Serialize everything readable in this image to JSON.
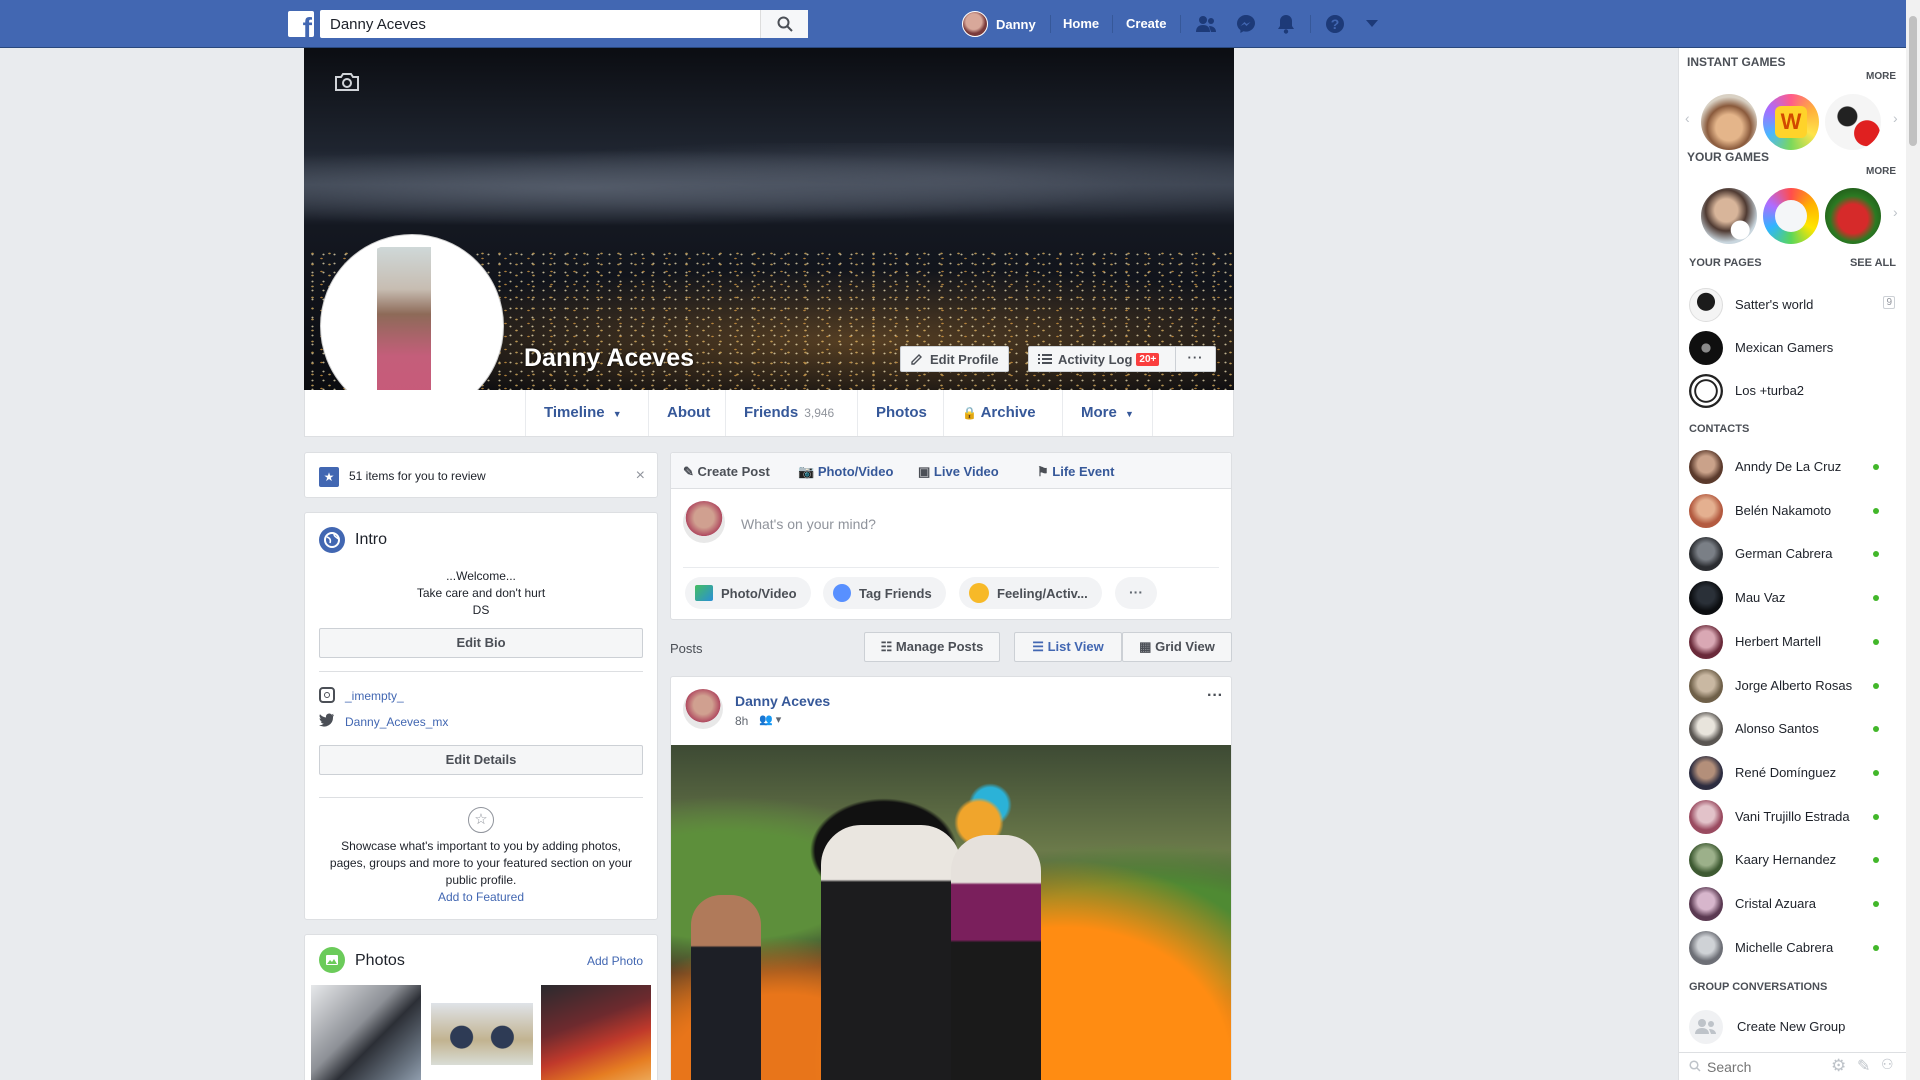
{
  "topbar": {
    "search_value": "Danny Aceves",
    "user_name": "Danny",
    "home": "Home",
    "create": "Create"
  },
  "profile": {
    "name": "Danny Aceves",
    "edit_profile": "Edit Profile",
    "activity_log": "Activity Log",
    "activity_badge": "20+",
    "more_dots": "···"
  },
  "tabs": {
    "timeline": "Timeline",
    "about": "About",
    "friends": "Friends",
    "friends_count": "3,946",
    "photos": "Photos",
    "archive": "Archive",
    "more": "More"
  },
  "review": {
    "text": "51 items for you to review"
  },
  "intro": {
    "title": "Intro",
    "bio_line1": "...Welcome...",
    "bio_line2": "Take care and don't hurt",
    "bio_line3": "DS",
    "edit_bio": "Edit Bio",
    "instagram": "_imempty_",
    "twitter": "Danny_Aceves_mx",
    "edit_details": "Edit Details",
    "featured_text": "Showcase what's important to you by adding photos, pages, groups and more to your featured section on your public profile.",
    "add_featured": "Add to Featured"
  },
  "photos": {
    "title": "Photos",
    "add": "Add Photo"
  },
  "composer": {
    "create_post": "Create Post",
    "photo_video": "Photo/Video",
    "live_video": "Live Video",
    "life_event": "Life Event",
    "placeholder": "What's on your mind?",
    "chip_photo": "Photo/Video",
    "chip_tag": "Tag Friends",
    "chip_feeling": "Feeling/Activ..."
  },
  "posts_bar": {
    "label": "Posts",
    "manage": "Manage Posts",
    "list_view": "List View",
    "grid_view": "Grid View"
  },
  "post": {
    "author": "Danny Aceves",
    "time": "8h"
  },
  "sidebar": {
    "instant_games": "INSTANT GAMES",
    "more1": "MORE",
    "your_games": "YOUR GAMES",
    "more2": "MORE",
    "your_pages": "YOUR PAGES",
    "see_all": "SEE ALL",
    "pages": [
      {
        "name": "Satter's world",
        "badge": "9"
      },
      {
        "name": "Mexican Gamers",
        "badge": ""
      },
      {
        "name": "Los +turba2",
        "badge": ""
      }
    ],
    "contacts_title": "CONTACTS",
    "contacts": [
      "Anndy De La Cruz",
      "Belén Nakamoto",
      "German Cabrera",
      "Mau Vaz",
      "Herbert Martell",
      "Jorge Alberto Rosas",
      "Alonso Santos",
      "René Domínguez",
      "Vani Trujillo Estrada",
      "Kaary Hernandez",
      "Cristal Azuara",
      "Michelle Cabrera"
    ],
    "group_conv": "GROUP CONVERSATIONS",
    "create_group": "Create New Group",
    "search_placeholder": "Search"
  },
  "colors": {
    "brand": "#4267b2",
    "link": "#365899",
    "online": "#42b72a",
    "badge": "#fa3e3e"
  }
}
